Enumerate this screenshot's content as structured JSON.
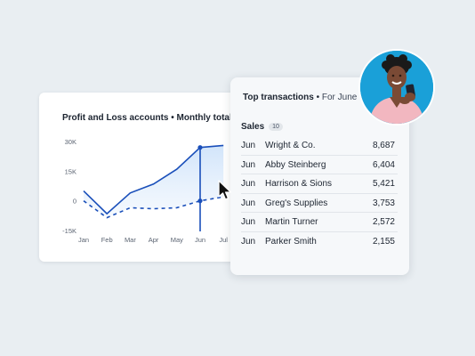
{
  "chart_card": {
    "title": "Profit and Loss accounts • Monthly total"
  },
  "chart_data": {
    "type": "line",
    "title": "Profit and Loss accounts • Monthly total",
    "categories": [
      "Jan",
      "Feb",
      "Mar",
      "Apr",
      "May",
      "Jun",
      "Jul"
    ],
    "y_ticks": [
      "30K",
      "15K",
      "0",
      "-15K"
    ],
    "ylim": [
      -15000,
      30000
    ],
    "series": [
      {
        "style": "solid",
        "values": [
          5000,
          -6500,
          4000,
          8500,
          16000,
          27000,
          28000
        ]
      },
      {
        "style": "dashed",
        "values": [
          0,
          -8500,
          -3500,
          -4000,
          -3500,
          0,
          2000
        ]
      }
    ],
    "highlight": "Jun",
    "grid": false,
    "colors": {
      "line": "#1a4fba",
      "fill": "#dcebfb",
      "marker_line": "#1a4fba"
    }
  },
  "transactions_card": {
    "title_main": "Top transactions",
    "title_sep": " • ",
    "title_sub": "For June",
    "section_label": "Sales",
    "section_count": "10",
    "rows": [
      {
        "month": "Jun",
        "name": "Wright & Co.",
        "amount": "8,687"
      },
      {
        "month": "Jun",
        "name": "Abby Steinberg",
        "amount": "6,404"
      },
      {
        "month": "Jun",
        "name": "Harrison & Sions",
        "amount": "5,421"
      },
      {
        "month": "Jun",
        "name": "Greg's Supplies",
        "amount": "3,753"
      },
      {
        "month": "Jun",
        "name": "Martin Turner",
        "amount": "2,572"
      },
      {
        "month": "Jun",
        "name": "Parker Smith",
        "amount": "2,155"
      }
    ]
  },
  "avatar": {
    "icon": "person-avatar-photo",
    "bg_color": "#1aa0d8"
  },
  "cursor": {
    "icon": "mouse-pointer-icon"
  }
}
